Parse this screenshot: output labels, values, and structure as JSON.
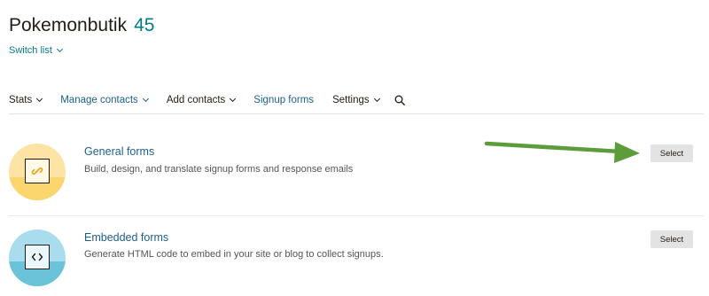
{
  "header": {
    "list_name": "Pokemonbutik",
    "list_count": "45",
    "switch_list_label": "Switch list"
  },
  "nav": {
    "items": [
      {
        "label": "Stats",
        "has_chevron": true
      },
      {
        "label": "Manage contacts",
        "has_chevron": true
      },
      {
        "label": "Add contacts",
        "has_chevron": true
      },
      {
        "label": "Signup forms",
        "has_chevron": false
      },
      {
        "label": "Settings",
        "has_chevron": true
      }
    ],
    "search_icon": "search-icon"
  },
  "forms": [
    {
      "title": "General forms",
      "description": "Build, design, and translate signup forms and response emails",
      "button_label": "Select",
      "icon": "link-icon"
    },
    {
      "title": "Embedded forms",
      "description": "Generate HTML code to embed in your site or blog to collect signups.",
      "button_label": "Select",
      "icon": "code-icon"
    }
  ],
  "annotation": {
    "arrow_color": "#5c9c3a"
  },
  "colors": {
    "accent_teal": "#007c89",
    "link_blue": "#1d5f8a",
    "button_gray": "#e3e3e3"
  }
}
